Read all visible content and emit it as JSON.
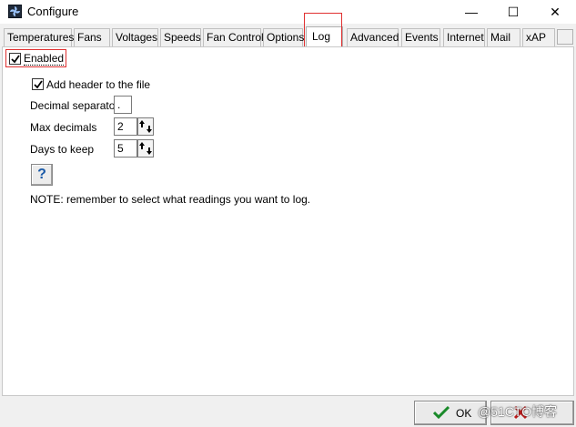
{
  "window": {
    "title": "Configure",
    "minimize_glyph": "—",
    "maximize_glyph": "☐",
    "close_glyph": "✕"
  },
  "tabs": [
    {
      "label": "Temperatures"
    },
    {
      "label": "Fans"
    },
    {
      "label": "Voltages"
    },
    {
      "label": "Speeds"
    },
    {
      "label": "Fan Control"
    },
    {
      "label": "Options"
    },
    {
      "label": "Log",
      "active": true
    },
    {
      "label": "Advanced"
    },
    {
      "label": "Events"
    },
    {
      "label": "Internet"
    },
    {
      "label": "Mail"
    },
    {
      "label": "xAP"
    }
  ],
  "log": {
    "enabled_label": "Enabled",
    "enabled_checked": true,
    "add_header_label": "Add header to the file",
    "add_header_checked": true,
    "decimal_separator_label": "Decimal separator",
    "decimal_separator_value": ".",
    "max_decimals_label": "Max decimals",
    "max_decimals_value": "2",
    "days_to_keep_label": "Days to keep",
    "days_to_keep_value": "5",
    "help_glyph": "?",
    "note": "NOTE: remember to select what readings you want to log."
  },
  "footer": {
    "ok_label": "OK",
    "watermark": "@51CTO博客"
  },
  "colors": {
    "highlight": "#e03030",
    "ok_check": "#1a8a2a",
    "cancel_x": "#c01818"
  }
}
